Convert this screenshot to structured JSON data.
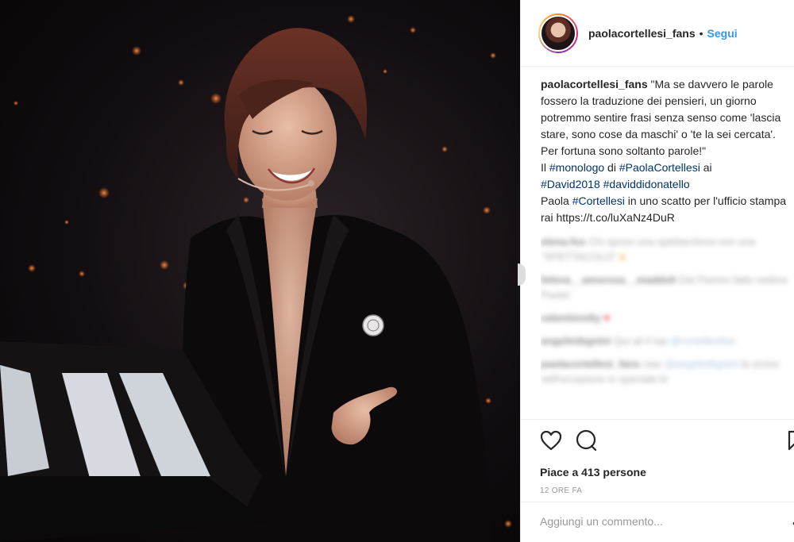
{
  "post": {
    "username": "paolacortellesi_fans",
    "dot": "•",
    "follow_label": "Segui",
    "caption": {
      "user": "paolacortellesi_fans",
      "quote": "\"Ma se davvero le parole fossero la traduzione dei pensieri, un giorno potremmo sentire frasi senza senso come 'lascia stare, sono cose da maschi' o 'te la sei cercata'. Per fortuna sono soltanto parole!\"",
      "line2_prefix": "Il ",
      "tag_monologo": "#monologo",
      "line2_di": " di ",
      "tag_paola": "#PaolaCortellesi",
      "line2_ai": " ai",
      "tag_david": "#David2018",
      "tag_davididonatello": "#daviddidonatello",
      "line4_prefix": "Paola ",
      "tag_cortellesi": "#Cortellesi",
      "line4_suffix": " in uno scatto per l'ufficio stampa rai https://t.co/luXaNz4DuR"
    },
    "blurred_comments": [
      {
        "user": "elena.fox",
        "text": "Chi sposo una spettacolosa non una \"SPETTACOLO\" ",
        "emoji": "●"
      },
      {
        "user": "felena__amorosa__maddoli",
        "text": "Dai l'hanno fatto vedere Paola!"
      },
      {
        "user": "valentiondiy",
        "text": "",
        "heart": "♥"
      },
      {
        "user": "angelinibgnini",
        "text": "Qui ali il top ",
        "link": "@cortellesifan"
      },
      {
        "user": "paolacortellesi_fans",
        "text": "ciao ",
        "link": "@angelinibgnini",
        "text2": " la scrivo nell'occasione in speciale bi"
      }
    ],
    "likes_text": "Piace a 413 persone",
    "time_ago": "12 ORE FA",
    "add_comment_placeholder": "Aggiungi un commento...",
    "more_dots": "•"
  }
}
